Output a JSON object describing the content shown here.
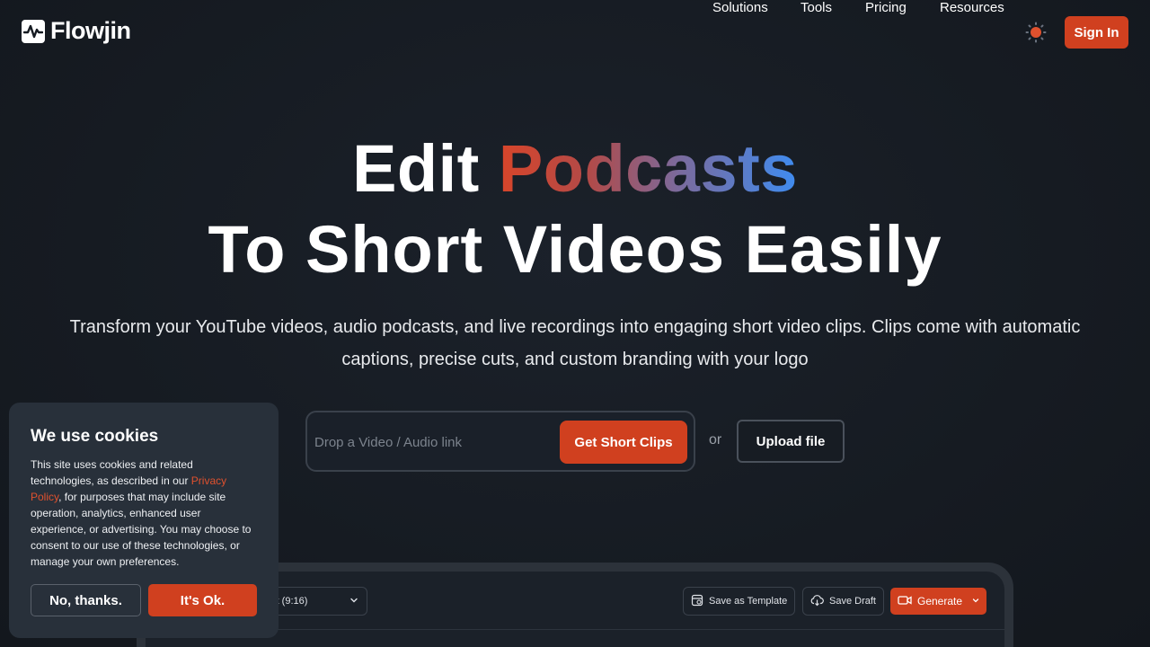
{
  "brand": {
    "name": "Flowjin",
    "logo_icon": "waveform-logo-icon"
  },
  "nav": {
    "items": [
      "Solutions",
      "Tools",
      "Pricing",
      "Resources"
    ],
    "theme_icon": "sun-icon",
    "signin_label": "Sign In"
  },
  "hero": {
    "line1_plain": "Edit",
    "line1_gradient": "Podcasts",
    "line2": "To Short Videos Easily",
    "subtitle": "Transform your YouTube videos, audio podcasts, and live recordings into engaging short video clips. Clips come with automatic captions, precise cuts, and custom branding with your logo"
  },
  "link_form": {
    "placeholder": "Drop a Video / Audio link",
    "value": "",
    "submit_label": "Get Short Clips",
    "or_text": "or",
    "upload_label": "Upload file"
  },
  "preview": {
    "aspect_value": "ait (9:16)",
    "save_template_label": "Save as Template",
    "save_draft_label": "Save Draft",
    "generate_label": "Generate"
  },
  "cookie": {
    "title": "We use cookies",
    "text_before": "This site uses cookies and related technologies, as described in our ",
    "link_text": "Privacy Policy",
    "text_after": ", for purposes that may include site operation, analytics, enhanced user experience, or advertising. You may choose to consent to our use of these technologies, or manage your own preferences.",
    "decline_label": "No, thanks.",
    "accept_label": "It's Ok."
  },
  "colors": {
    "accent": "#d0401f",
    "background": "#161b22",
    "gradient": [
      "#d8452a",
      "#7b6a9c",
      "#3f8cf0"
    ]
  }
}
